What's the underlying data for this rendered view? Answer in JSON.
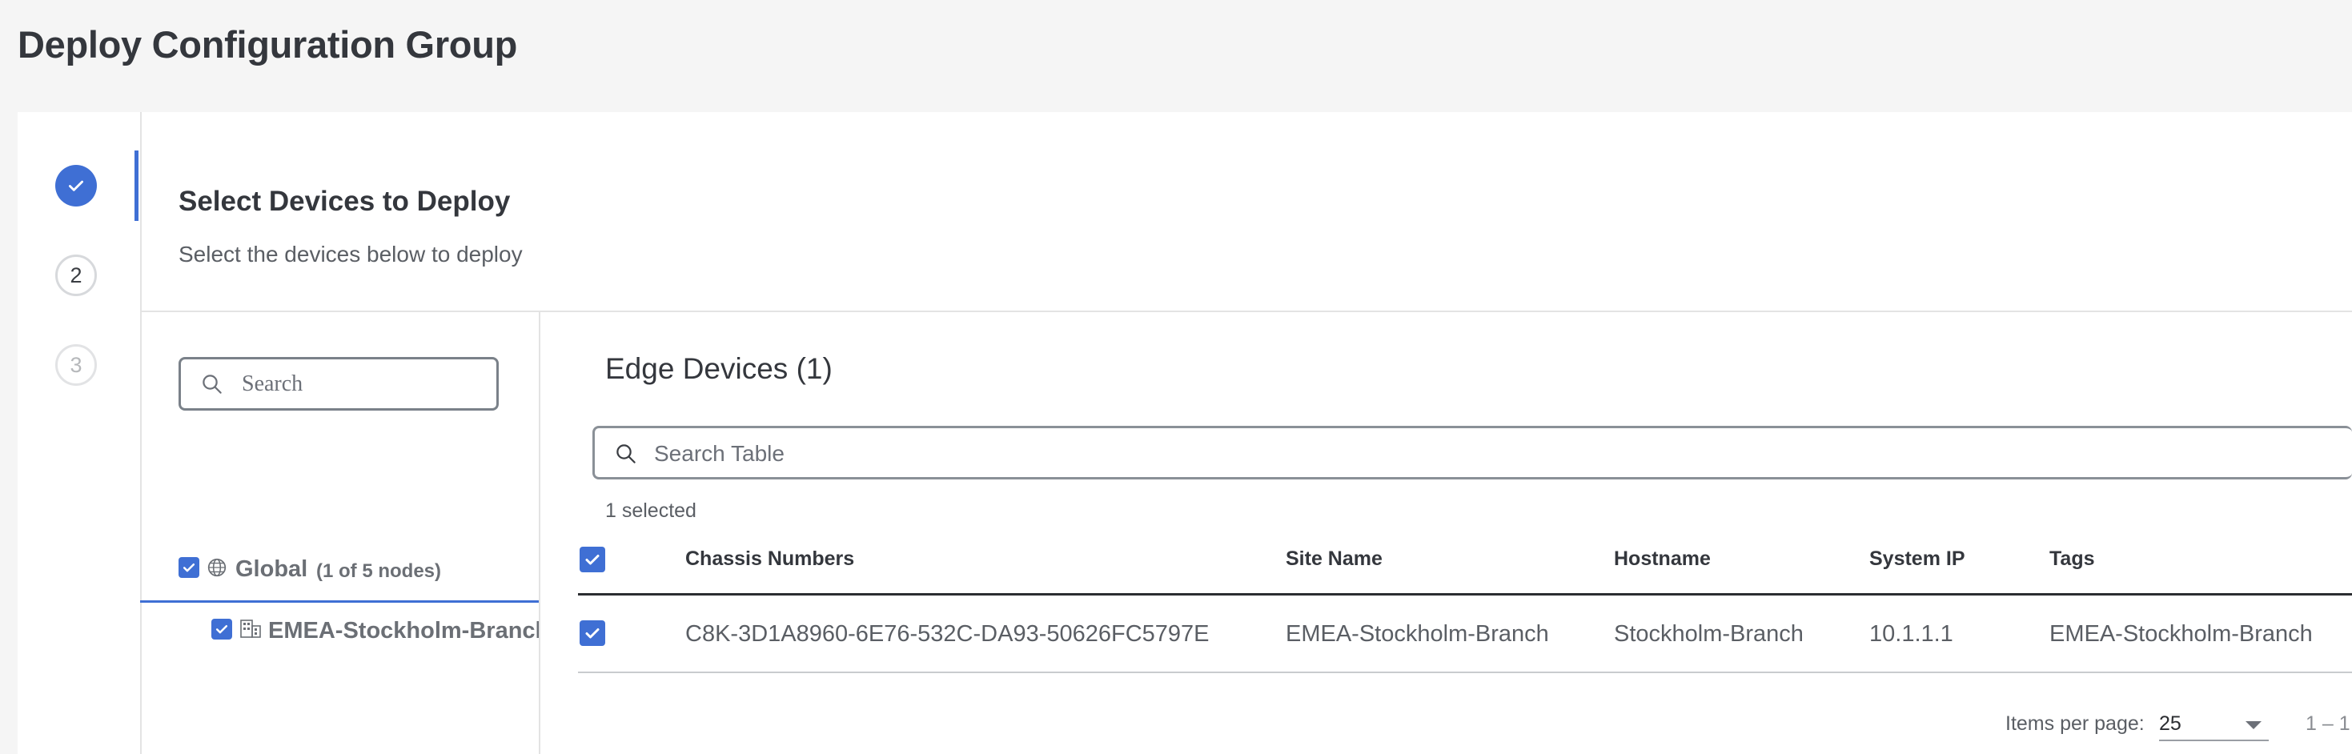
{
  "page": {
    "title": "Deploy Configuration Group"
  },
  "stepper": {
    "steps": [
      {
        "label": "",
        "state": "completed"
      },
      {
        "label": "2",
        "state": "current"
      },
      {
        "label": "3",
        "state": "upcoming"
      }
    ]
  },
  "section": {
    "title": "Select Devices to Deploy",
    "subtitle": "Select the devices below to deploy"
  },
  "tree": {
    "search_placeholder": "Search",
    "global": {
      "label": "Global",
      "count": "(1 of 5 nodes)",
      "checked": true,
      "icon": "globe-icon"
    },
    "children": [
      {
        "label": "EMEA-Stockholm-Branch",
        "checked": true,
        "icon": "building-icon"
      }
    ]
  },
  "edge_devices": {
    "title": "Edge Devices (1)",
    "search_placeholder": "Search Table",
    "selected_text": "1 selected",
    "columns": [
      "Chassis Numbers",
      "Site Name",
      "Hostname",
      "System IP",
      "Tags"
    ],
    "rows": [
      {
        "checked": true,
        "chassis": "C8K-3D1A8960-6E76-532C-DA93-50626FC5797E",
        "site_name": "EMEA-Stockholm-Branch",
        "hostname": "Stockholm-Branch",
        "system_ip": "10.1.1.1",
        "tags": "EMEA-Stockholm-Branch"
      }
    ]
  },
  "pagination": {
    "items_per_page_label": "Items per page:",
    "items_per_page_value": "25",
    "range_text": "1 – 1"
  },
  "colors": {
    "accent": "#3f6fd4",
    "title": "#34373d",
    "muted": "#5a5e64"
  }
}
